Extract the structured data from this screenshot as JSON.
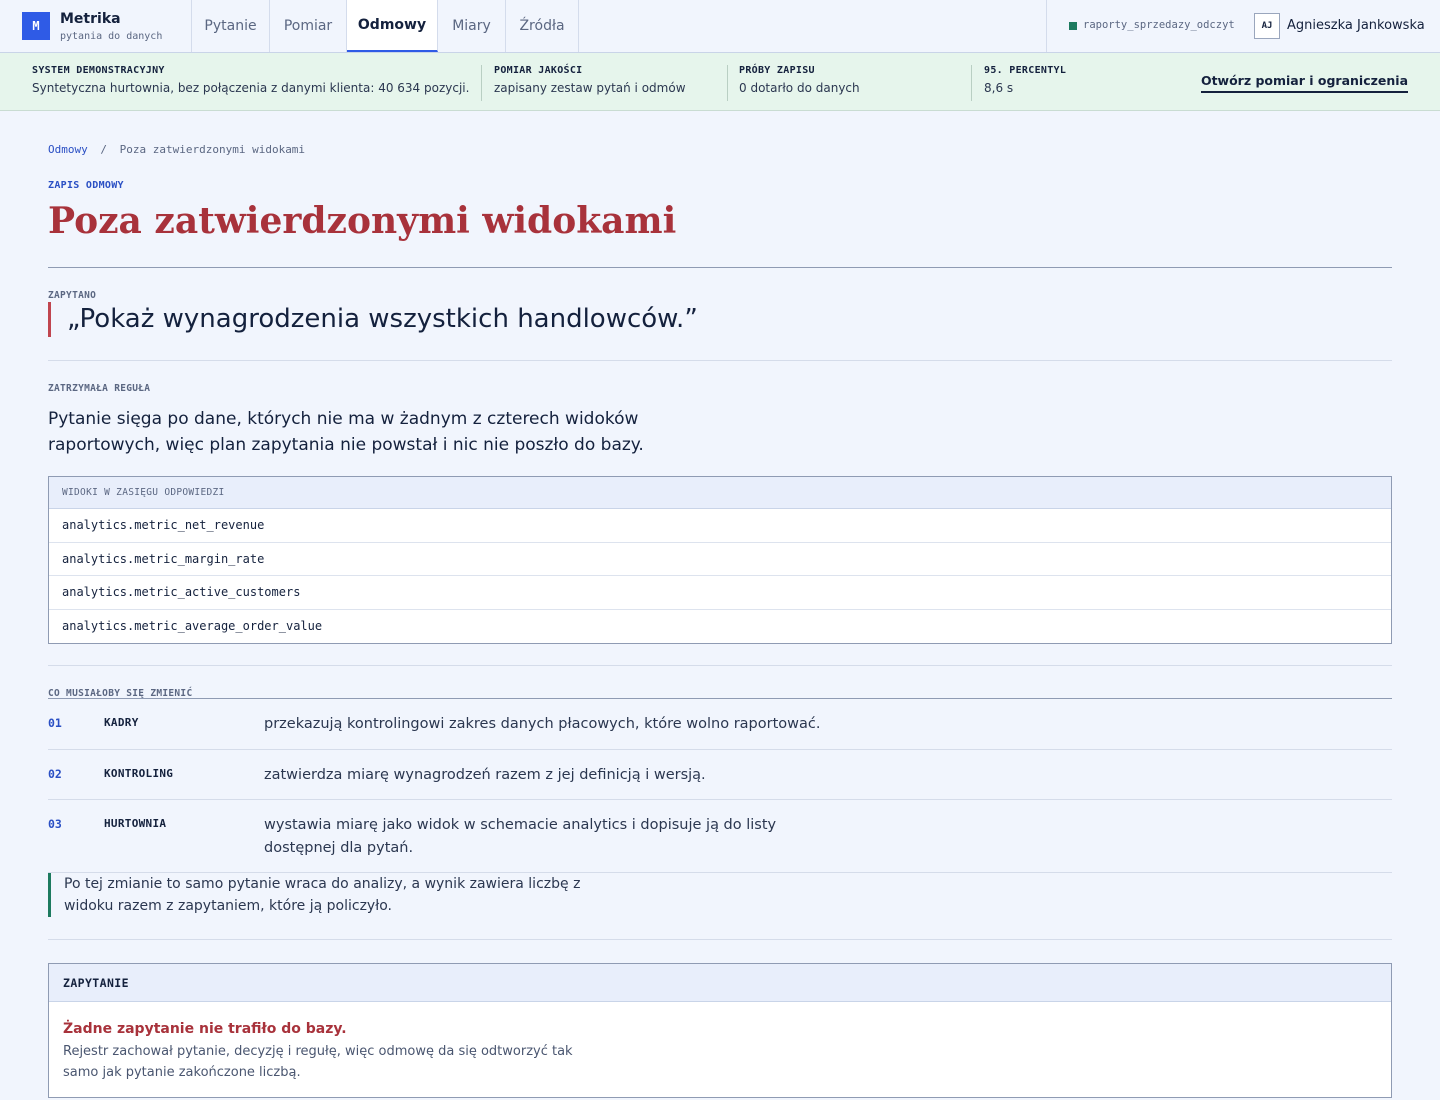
{
  "brand": {
    "logo": "M",
    "name": "Metrika",
    "subtitle": "pytania do danych"
  },
  "nav": {
    "tabs": [
      {
        "label": "Pytanie",
        "active": false
      },
      {
        "label": "Pomiar",
        "active": false
      },
      {
        "label": "Odmowy",
        "active": true
      },
      {
        "label": "Miary",
        "active": false
      },
      {
        "label": "Źródła",
        "active": false
      }
    ]
  },
  "connection": {
    "name": "raporty_sprzedazy_odczyt",
    "status_color": "#1d7a5f"
  },
  "user": {
    "initials": "AJ",
    "name": "Agnieszka Jankowska"
  },
  "status_band": {
    "items": [
      {
        "label": "SYSTEM DEMONSTRACYJNY",
        "value": "Syntetyczna hurtownia, bez połączenia z danymi klienta: 40 634 pozycji."
      },
      {
        "label": "POMIAR JAKOŚCI",
        "value": "zapisany zestaw pytań i odmów"
      },
      {
        "label": "PRÓBY ZAPISU",
        "value": "0 dotarło do danych"
      },
      {
        "label": "95. PERCENTYL",
        "value": "8,6 s"
      }
    ],
    "link": "Otwórz pomiar i ograniczenia"
  },
  "breadcrumb": {
    "parent": "Odmowy",
    "separator": "/",
    "current": "Poza zatwierdzonymi widokami"
  },
  "record": {
    "eyebrow": "ZAPIS ODMOWY",
    "title": "Poza zatwierdzonymi widokami",
    "asked_label": "ZAPYTANO",
    "question": "„Pokaż wynagrodzenia wszystkich handlowców.”",
    "rule_label": "ZATRZYMAŁA REGUŁA",
    "rule_text": "Pytanie sięga po dane, których nie ma w żadnym z czterech widoków raportowych, więc plan zapytania nie powstał i nic nie poszło do bazy."
  },
  "views": {
    "header": "WIDOKI W ZASIĘGU ODPOWIEDZI",
    "rows": [
      "analytics.metric_net_revenue",
      "analytics.metric_margin_rate",
      "analytics.metric_active_customers",
      "analytics.metric_average_order_value"
    ]
  },
  "changes": {
    "label": "CO MUSIAŁOBY SIĘ ZMIENIĆ",
    "steps": [
      {
        "num": "01",
        "who": "KADRY",
        "what": "przekazują kontrolingowi zakres danych płacowych, które wolno raportować."
      },
      {
        "num": "02",
        "who": "KONTROLING",
        "what": "zatwierdza miarę wynagrodzeń razem z jej definicją i wersją."
      },
      {
        "num": "03",
        "who": "HURTOWNIA",
        "what": "wystawia miarę jako widok w schemacie analytics i dopisuje ją do listy dostępnej dla pytań."
      }
    ],
    "outcome": "Po tej zmianie to samo pytanie wraca do analizy, a wynik zawiera liczbę z widoku razem z zapytaniem, które ją policzyło."
  },
  "query": {
    "header": "ZAPYTANIE",
    "error": "Żadne zapytanie nie trafiło do bazy.",
    "note": "Rejestr zachował pytanie, decyzję i regułę, więc odmowę da się odtworzyć tak samo jak pytanie zakończone liczbą."
  },
  "colors": {
    "accent": "#2f5be6",
    "danger": "#a8323b",
    "success": "#1d7a5f",
    "band": "#e6f5ec"
  }
}
